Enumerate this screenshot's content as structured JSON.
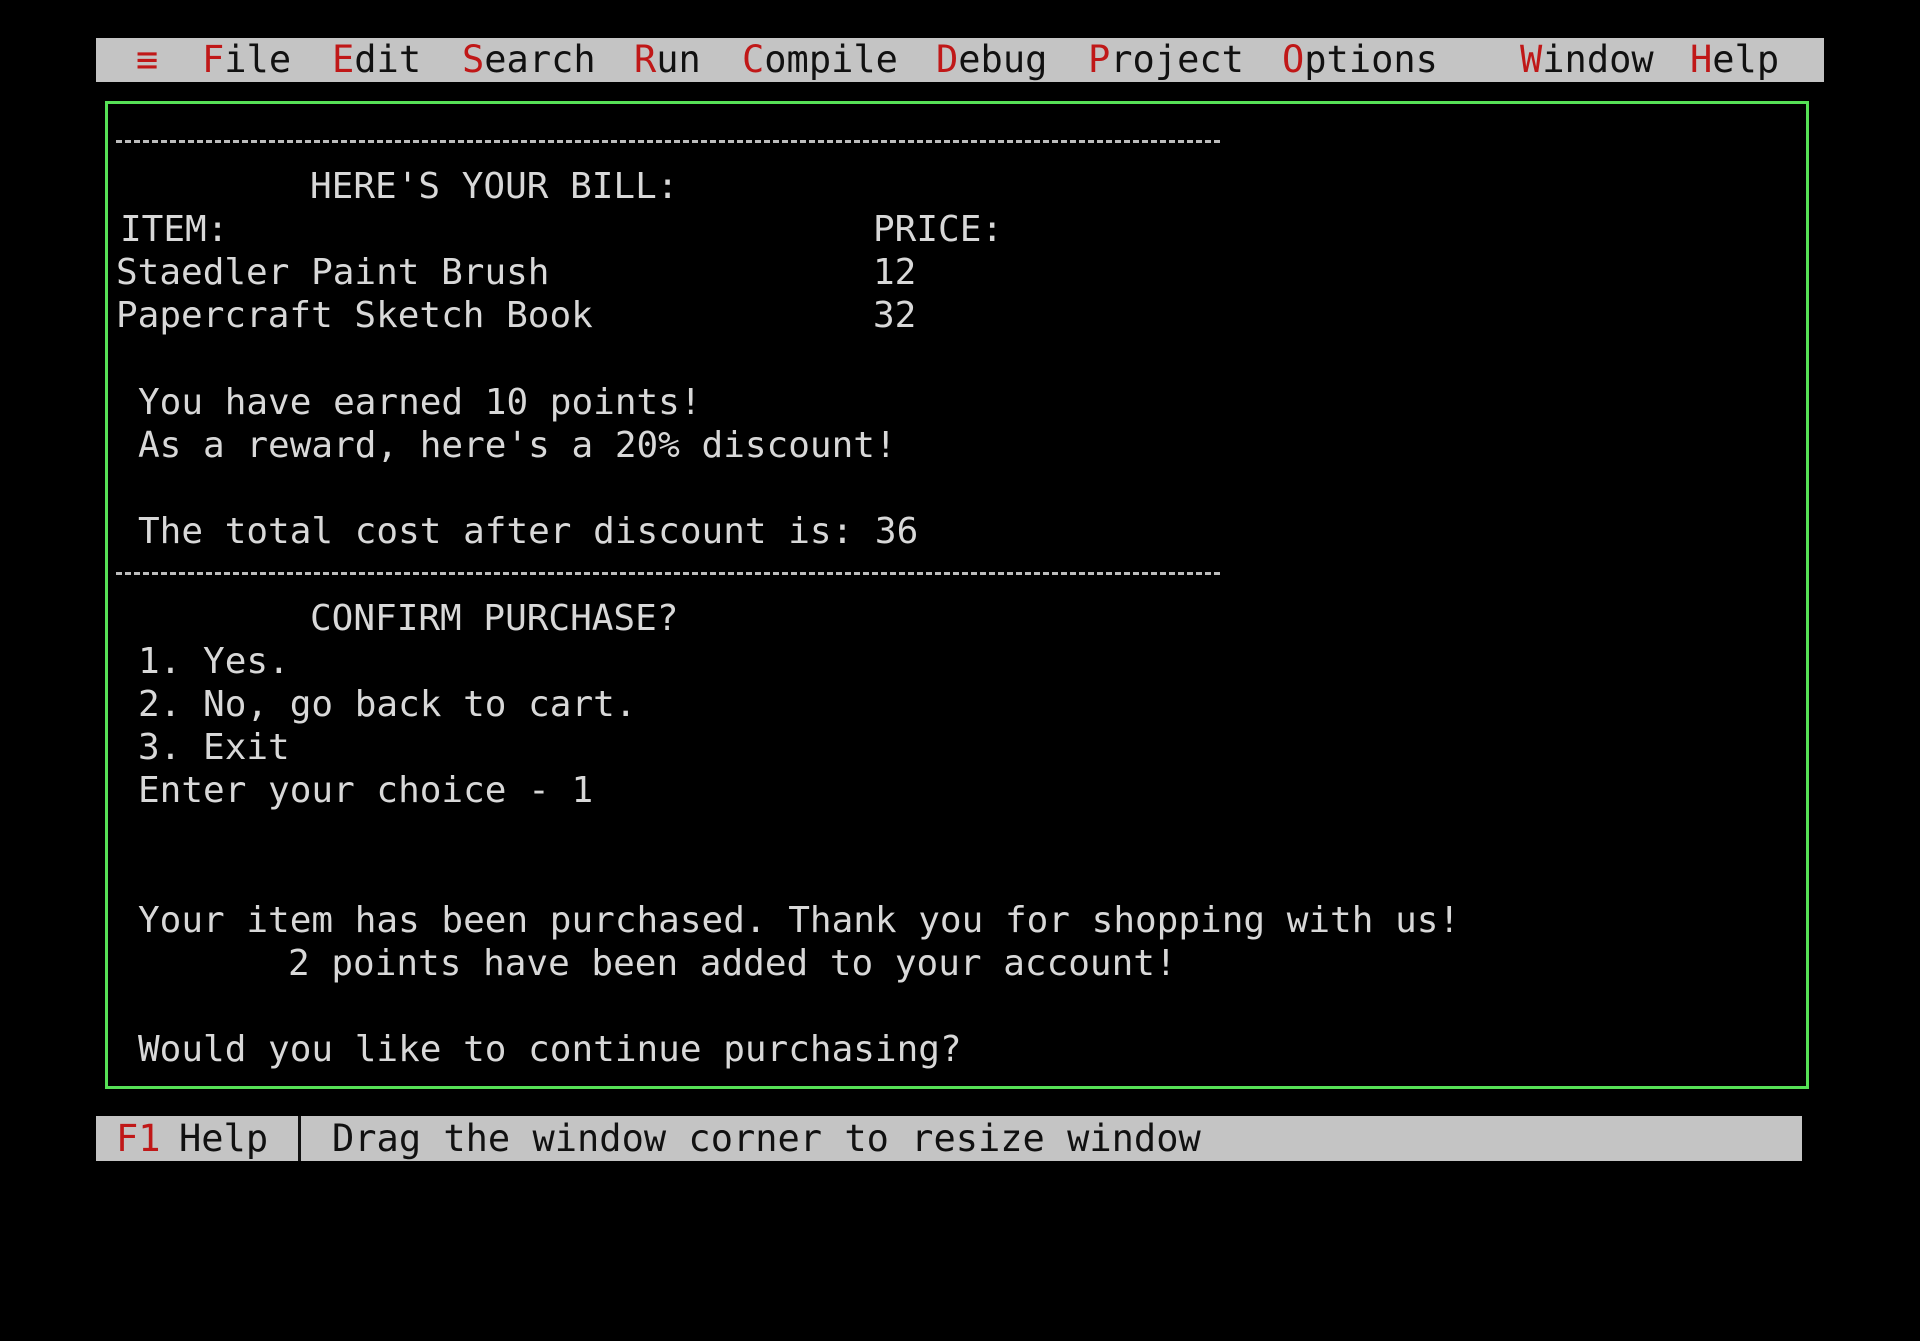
{
  "menubar": {
    "system_menu_glyph": "≡",
    "items": [
      {
        "hot": "F",
        "rest": "ile"
      },
      {
        "hot": "E",
        "rest": "dit"
      },
      {
        "hot": "S",
        "rest": "earch"
      },
      {
        "hot": "R",
        "rest": "un"
      },
      {
        "hot": "C",
        "rest": "ompile"
      },
      {
        "hot": "D",
        "rest": "ebug"
      },
      {
        "hot": "P",
        "rest": "roject"
      },
      {
        "hot": "O",
        "rest": "ptions"
      },
      {
        "hot": "W",
        "rest": "indow"
      },
      {
        "hot": "H",
        "rest": "elp"
      }
    ]
  },
  "output": {
    "bill_heading": "HERE'S YOUR BILL:",
    "item_header": "ITEM:",
    "price_header": "PRICE:",
    "bill_items": [
      {
        "item": "Staedler Paint Brush",
        "price": "12"
      },
      {
        "item": "Papercraft Sketch Book",
        "price": "32"
      }
    ],
    "points_msg": "You have earned 10 points!",
    "discount_msg": "As a reward, here's a 20% discount!",
    "total_msg": "The total cost after discount is: 36",
    "confirm_heading": "CONFIRM PURCHASE?",
    "options": [
      "1. Yes.",
      "2. No, go back to cart.",
      "3. Exit"
    ],
    "choice_prompt": "Enter your choice - 1",
    "purchased_msg": "Your item has been purchased. Thank you for shopping with us!",
    "points_added_msg": "2 points have been added to your account!",
    "continue_prompt": "Would you like to continue purchasing?"
  },
  "statusbar": {
    "key": "F1",
    "key_label": "Help",
    "hint": "Drag the window corner to resize window"
  },
  "colors": {
    "menubar_bg": "#c4c4c4",
    "hotkey": "#c01818",
    "window_border": "#56e056",
    "screen_bg": "#000000",
    "text": "#d8d8d8"
  }
}
